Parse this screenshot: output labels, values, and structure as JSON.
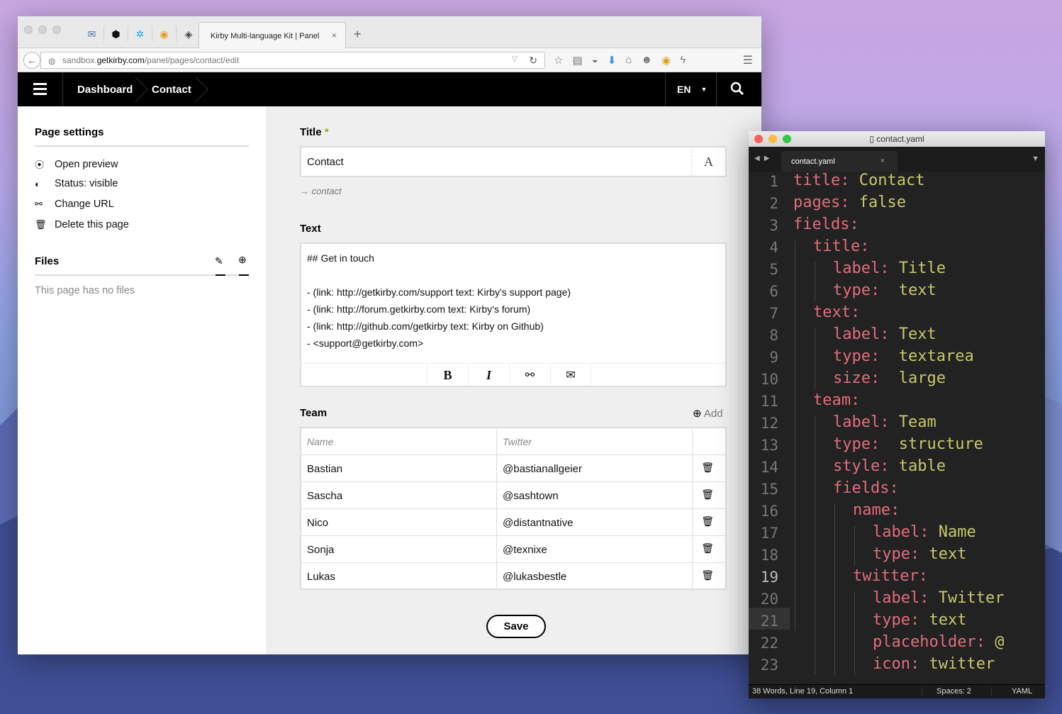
{
  "browser": {
    "tab_title": "Kirby Multi-language Kit | Panel",
    "tab_close": "×",
    "new_tab": "+",
    "url_prefix": "sandbox.",
    "url_domain": "getkirby.com",
    "url_path": "/panel/pages/contact/edit"
  },
  "nav": {
    "crumbs": [
      "Dashboard",
      "Contact"
    ],
    "lang": "EN"
  },
  "sidebar": {
    "page_settings_heading": "Page settings",
    "actions": [
      {
        "label": "Open preview",
        "icon": "preview-icon"
      },
      {
        "label": "Status: visible",
        "icon": "toggle-icon"
      },
      {
        "label": "Change URL",
        "icon": "link-icon"
      },
      {
        "label": "Delete this page",
        "icon": "trash-icon"
      }
    ],
    "files_heading": "Files",
    "no_files": "This page has no files"
  },
  "form": {
    "title_label": "Title",
    "required_mark": "*",
    "title_value": "Contact",
    "title_icon": "A",
    "slug": "contact",
    "text_label": "Text",
    "text_lines": [
      "## Get in touch",
      "",
      "- (link: http://getkirby.com/support text: Kirby's support page)",
      "- (link: http://forum.getkirby.com text: Kirby's forum)",
      "- (link: http://github.com/getkirby text: Kirby on Github)",
      "- <support@getkirby.com>"
    ],
    "toolbar": {
      "bold": "B",
      "italic": "I"
    },
    "team_label": "Team",
    "add_label": "Add",
    "columns": [
      "Name",
      "Twitter"
    ],
    "rows": [
      {
        "name": "Bastian",
        "twitter": "@bastianallgeier"
      },
      {
        "name": "Sascha",
        "twitter": "@sashtown"
      },
      {
        "name": "Nico",
        "twitter": "@distantnative"
      },
      {
        "name": "Sonja",
        "twitter": "@texnixe"
      },
      {
        "name": "Lukas",
        "twitter": "@lukasbestle"
      }
    ],
    "save_label": "Save"
  },
  "editor": {
    "window_title": "contact.yaml",
    "tab_label": "contact.yaml",
    "tab_close": "×",
    "lines": [
      {
        "n": "1",
        "indent": 0,
        "key": "title:",
        "value": " Contact"
      },
      {
        "n": "2",
        "indent": 0,
        "key": "pages:",
        "value": " false"
      },
      {
        "n": "3",
        "indent": 0,
        "key": "fields:",
        "value": ""
      },
      {
        "n": "4",
        "indent": 1,
        "key": "title:",
        "value": ""
      },
      {
        "n": "5",
        "indent": 2,
        "key": "label:",
        "value": " Title"
      },
      {
        "n": "6",
        "indent": 2,
        "key": "type:",
        "value": "  text"
      },
      {
        "n": "7",
        "indent": 1,
        "key": "text:",
        "value": ""
      },
      {
        "n": "8",
        "indent": 2,
        "key": "label:",
        "value": " Text"
      },
      {
        "n": "9",
        "indent": 2,
        "key": "type:",
        "value": "  textarea"
      },
      {
        "n": "10",
        "indent": 2,
        "key": "size:",
        "value": "  large"
      },
      {
        "n": "11",
        "indent": 1,
        "key": "team:",
        "value": ""
      },
      {
        "n": "12",
        "indent": 2,
        "key": "label:",
        "value": " Team"
      },
      {
        "n": "13",
        "indent": 2,
        "key": "type:",
        "value": "  structure"
      },
      {
        "n": "14",
        "indent": 2,
        "key": "style:",
        "value": " table"
      },
      {
        "n": "15",
        "indent": 2,
        "key": "fields:",
        "value": ""
      },
      {
        "n": "16",
        "indent": 3,
        "key": "name:",
        "value": ""
      },
      {
        "n": "17",
        "indent": 4,
        "key": "label:",
        "value": " Name"
      },
      {
        "n": "18",
        "indent": 4,
        "key": "type:",
        "value": " text"
      },
      {
        "n": "19",
        "indent": 3,
        "key": "twitter:",
        "value": ""
      },
      {
        "n": "20",
        "indent": 4,
        "key": "label:",
        "value": " Twitter"
      },
      {
        "n": "21",
        "indent": 4,
        "key": "type:",
        "value": " text"
      },
      {
        "n": "22",
        "indent": 4,
        "key": "placeholder:",
        "value": " @"
      },
      {
        "n": "23",
        "indent": 4,
        "key": "icon:",
        "value": " twitter"
      }
    ],
    "current_line": "19",
    "status_left": "38 Words, Line 19, Column 1",
    "status_spaces": "Spaces: 2",
    "status_syntax": "YAML"
  },
  "colors": {
    "yaml_key": "#e26d7c",
    "yaml_value": "#c6c86a",
    "required_mark": "#8da71d"
  }
}
